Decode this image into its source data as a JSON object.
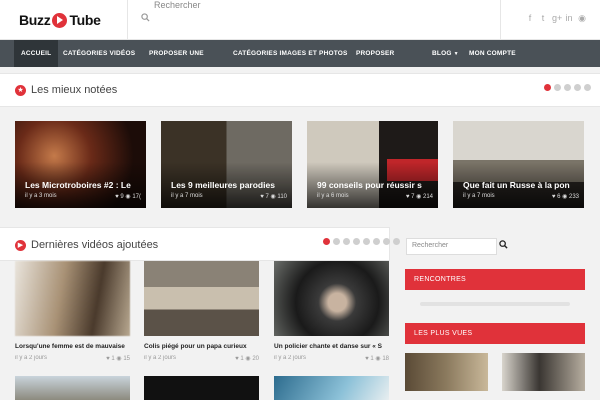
{
  "header": {
    "logo": {
      "word1": "Buzz",
      "word2": "Tube"
    },
    "search_placeholder": "Rechercher",
    "social_icons": [
      "facebook-icon",
      "twitter-icon",
      "google-plus-icon",
      "linkedin-icon",
      "rss-icon"
    ]
  },
  "nav": {
    "items": [
      {
        "label": "Accueil"
      },
      {
        "label": "Catégories vidéos"
      },
      {
        "label": "Proposer une"
      },
      {
        "label": "Catégories images et photos"
      },
      {
        "label": "Proposer"
      },
      {
        "label": "Blog"
      },
      {
        "label": "Mon compte"
      }
    ]
  },
  "top_rated": {
    "title": "Les mieux notées",
    "active_dot": 1,
    "dot_count": 5,
    "cards": [
      {
        "title": "Les Microtroboires #2 : Le",
        "time": "il y a 3 mois",
        "likes": "9",
        "views": "17("
      },
      {
        "title": "Les 9 meilleures parodies",
        "time": "il y a 7 mois",
        "likes": "7",
        "views": "110"
      },
      {
        "title": "99 conseils pour réussir s",
        "time": "il y a 6 mois",
        "likes": "7",
        "views": "214"
      },
      {
        "title": "Que fait un Russe à la pon",
        "time": "il y a 7 mois",
        "likes": "6",
        "views": "233"
      }
    ]
  },
  "latest": {
    "title": "Dernières vidéos ajoutées",
    "active_dot": 1,
    "dot_count": 8,
    "videos": [
      {
        "title": "Lorsqu'une femme est de mauvaise",
        "time": "il y a 2 jours",
        "likes": "1",
        "views": "15"
      },
      {
        "title": "Colis piégé pour un papa curieux",
        "time": "il y a 2 jours",
        "likes": "1",
        "views": "20"
      },
      {
        "title": "Un policier chante et danse sur « S",
        "time": "il y a 2 jours",
        "likes": "1",
        "views": "18"
      }
    ]
  },
  "sidebar": {
    "search_placeholder": "Rechercher",
    "rencontres_label": "Rencontres",
    "plus_vues_label": "Les plus vues"
  },
  "colors": {
    "accent": "#e0323a",
    "nav_bg": "#4a5157",
    "nav_active": "#2f3539"
  }
}
